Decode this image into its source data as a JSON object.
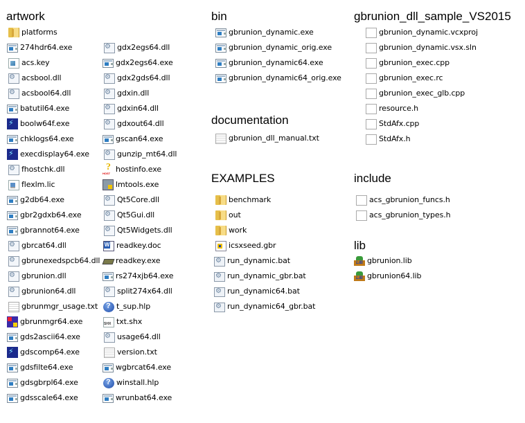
{
  "groups": [
    {
      "title": "artwork",
      "items": [
        {
          "name": "platforms",
          "icon": "folder"
        },
        {
          "name": "274hdr64.exe",
          "icon": "exe"
        },
        {
          "name": "acs.key",
          "icon": "key"
        },
        {
          "name": "acsbool.dll",
          "icon": "dll"
        },
        {
          "name": "acsbool64.dll",
          "icon": "dll"
        },
        {
          "name": "batutil64.exe",
          "icon": "exe"
        },
        {
          "name": "boolw64f.exe",
          "icon": "app"
        },
        {
          "name": "chklogs64.exe",
          "icon": "exe"
        },
        {
          "name": "execdisplay64.exe",
          "icon": "app"
        },
        {
          "name": "fhostchk.dll",
          "icon": "dll"
        },
        {
          "name": "flexlm.lic",
          "icon": "lic"
        },
        {
          "name": "g2db64.exe",
          "icon": "exe"
        },
        {
          "name": "gbr2gdxb64.exe",
          "icon": "exe"
        },
        {
          "name": "gbrannot64.exe",
          "icon": "exe"
        },
        {
          "name": "gbrcat64.dll",
          "icon": "dll"
        },
        {
          "name": "gbrunexedspcb64.dll",
          "icon": "dll"
        },
        {
          "name": "gbrunion.dll",
          "icon": "dll"
        },
        {
          "name": "gbrunion64.dll",
          "icon": "dll"
        },
        {
          "name": "gbrunmgr_usage.txt",
          "icon": "txt"
        },
        {
          "name": "gbrunmgr64.exe",
          "icon": "mgr"
        },
        {
          "name": "gds2ascii64.exe",
          "icon": "exe"
        },
        {
          "name": "gdscomp64.exe",
          "icon": "app"
        },
        {
          "name": "gdsfilte64.exe",
          "icon": "exe"
        },
        {
          "name": "gdsgbrpl64.exe",
          "icon": "exe"
        },
        {
          "name": "gdsscale64.exe",
          "icon": "exe"
        },
        {
          "name": "gdx2egs64.dll",
          "icon": "dll"
        },
        {
          "name": "gdx2egs64.exe",
          "icon": "exe"
        },
        {
          "name": "gdx2gds64.dll",
          "icon": "dll"
        },
        {
          "name": "gdxin.dll",
          "icon": "dll"
        },
        {
          "name": "gdxin64.dll",
          "icon": "dll"
        },
        {
          "name": "gdxout64.dll",
          "icon": "dll"
        },
        {
          "name": "gscan64.exe",
          "icon": "exe"
        },
        {
          "name": "gunzip_mt64.dll",
          "icon": "dll"
        },
        {
          "name": "hostinfo.exe",
          "icon": "host"
        },
        {
          "name": "lmtools.exe",
          "icon": "lm"
        },
        {
          "name": "Qt5Core.dll",
          "icon": "dll"
        },
        {
          "name": "Qt5Gui.dll",
          "icon": "dll"
        },
        {
          "name": "Qt5Widgets.dll",
          "icon": "dll"
        },
        {
          "name": "readkey.doc",
          "icon": "word"
        },
        {
          "name": "readkey.exe",
          "icon": "drive"
        },
        {
          "name": "rs274xjb64.exe",
          "icon": "exe"
        },
        {
          "name": "split274x64.dll",
          "icon": "dll"
        },
        {
          "name": "t_sup.hlp",
          "icon": "help"
        },
        {
          "name": "txt.shx",
          "icon": "shx"
        },
        {
          "name": "usage64.dll",
          "icon": "dll"
        },
        {
          "name": "version.txt",
          "icon": "txt"
        },
        {
          "name": "wgbrcat64.exe",
          "icon": "exe"
        },
        {
          "name": "winstall.hlp",
          "icon": "help"
        },
        {
          "name": "wrunbat64.exe",
          "icon": "exe"
        }
      ]
    },
    {
      "title": "bin",
      "items": [
        {
          "name": "gbrunion_dynamic.exe",
          "icon": "exe"
        },
        {
          "name": "gbrunion_dynamic_orig.exe",
          "icon": "exe"
        },
        {
          "name": "gbrunion_dynamic64.exe",
          "icon": "exe"
        },
        {
          "name": "gbrunion_dynamic64_orig.exe",
          "icon": "exe"
        }
      ]
    },
    {
      "title": "documentation",
      "items": [
        {
          "name": "gbrunion_dll_manual.txt",
          "icon": "txt"
        }
      ]
    },
    {
      "title": "EXAMPLES",
      "items": [
        {
          "name": "benchmark",
          "icon": "folder"
        },
        {
          "name": "out",
          "icon": "folder"
        },
        {
          "name": "work",
          "icon": "folder"
        },
        {
          "name": "icsxseed.gbr",
          "icon": "gbr"
        },
        {
          "name": "run_dynamic.bat",
          "icon": "bat"
        },
        {
          "name": "run_dynamic_gbr.bat",
          "icon": "bat"
        },
        {
          "name": "run_dynamic64.bat",
          "icon": "bat"
        },
        {
          "name": "run_dynamic64_gbr.bat",
          "icon": "bat"
        }
      ]
    },
    {
      "title": "gbrunion_dll_sample_VS2015",
      "items": [
        {
          "name": "gbrunion_dynamic.vcxproj",
          "icon": "blank"
        },
        {
          "name": "gbrunion_dynamic.vsx.sln",
          "icon": "blank"
        },
        {
          "name": "gbrunion_exec.cpp",
          "icon": "blank"
        },
        {
          "name": "gbrunion_exec.rc",
          "icon": "blank"
        },
        {
          "name": "gbrunion_exec_glb.cpp",
          "icon": "blank"
        },
        {
          "name": "resource.h",
          "icon": "blank"
        },
        {
          "name": "StdAfx.cpp",
          "icon": "blank"
        },
        {
          "name": "StdAfx.h",
          "icon": "blank"
        }
      ]
    },
    {
      "title": "include",
      "items": [
        {
          "name": "acs_gbrunion_funcs.h",
          "icon": "blank"
        },
        {
          "name": "acs_gbrunion_types.h",
          "icon": "blank"
        }
      ]
    },
    {
      "title": "lib",
      "items": [
        {
          "name": "gbrunion.lib",
          "icon": "lib"
        },
        {
          "name": "gbrunion64.lib",
          "icon": "lib"
        }
      ]
    }
  ]
}
